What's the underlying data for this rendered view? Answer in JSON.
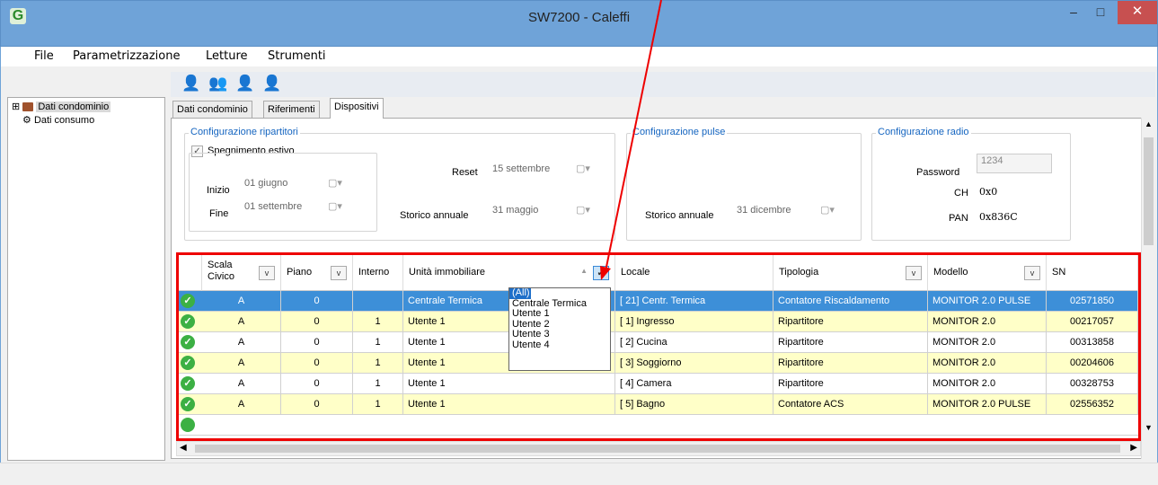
{
  "window": {
    "title": "SW7200 - Caleffi",
    "app_icon_glyph": "G",
    "minimize": "–",
    "maximize": "□",
    "close": "✕"
  },
  "menu": [
    "File",
    "Parametrizzazione",
    "Letture",
    "Strumenti"
  ],
  "toolbar": {
    "icons": [
      "add-user-icon",
      "users-icon",
      "user-arrow-icon",
      "user-remove-icon"
    ]
  },
  "tree": {
    "items": [
      {
        "label": "Dati condominio",
        "expander": "⊞"
      },
      {
        "label": "Dati consumo"
      }
    ]
  },
  "tabs": [
    "Dati condominio",
    "Riferimenti",
    "Dispositivi"
  ],
  "config_ripartitori": {
    "legend": "Configurazione ripartitori",
    "spegnimento": {
      "label": "Spegnimento estivo",
      "checked": true
    },
    "inizio_label": "Inizio",
    "inizio_value": "01  giugno",
    "fine_label": "Fine",
    "fine_value": "01 settembre",
    "reset_label": "Reset",
    "reset_value": "15 settembre",
    "storico_label": "Storico annuale",
    "storico_value": "31  maggio"
  },
  "config_pulse": {
    "legend": "Configurazione pulse",
    "storico_label": "Storico annuale",
    "storico_value": "31 dicembre"
  },
  "config_radio": {
    "legend": "Configurazione radio",
    "password_label": "Password",
    "password_value": "1234",
    "ch_label": "CH",
    "ch_value": "0x0",
    "pan_label": "PAN",
    "pan_value": "0x836C"
  },
  "grid": {
    "headers": [
      {
        "key": "scala",
        "label": "Scala\nCivico",
        "filter": true
      },
      {
        "key": "piano",
        "label": "Piano",
        "filter": true
      },
      {
        "key": "interno",
        "label": "Interno",
        "filter": false
      },
      {
        "key": "unita",
        "label": "Unità immobiliare",
        "filter": true,
        "sort": "▲"
      },
      {
        "key": "locale",
        "label": "Locale",
        "filter": false
      },
      {
        "key": "tipologia",
        "label": "Tipologia",
        "filter": true
      },
      {
        "key": "modello",
        "label": "Modello",
        "filter": true
      },
      {
        "key": "sn",
        "label": "SN",
        "filter": false
      }
    ],
    "filter_glyph": "✓",
    "dropdown_glyph": "v",
    "status_glyph": "✓",
    "rows": [
      {
        "scala": "A",
        "piano": "0",
        "interno": "",
        "unita": "Centrale Termica",
        "locale": "[ 21] Centr. Termica",
        "tipologia": "Contatore Riscaldamento",
        "modello": "MONITOR 2.0 PULSE",
        "sn": "02571850",
        "style": "selected"
      },
      {
        "scala": "A",
        "piano": "0",
        "interno": "1",
        "unita": "Utente 1",
        "locale": "[  1] Ingresso",
        "tipologia": "Ripartitore",
        "modello": "MONITOR 2.0",
        "sn": "00217057",
        "style": "yellow"
      },
      {
        "scala": "A",
        "piano": "0",
        "interno": "1",
        "unita": "Utente 1",
        "locale": "[  2] Cucina",
        "tipologia": "Ripartitore",
        "modello": "MONITOR 2.0",
        "sn": "00313858",
        "style": "white"
      },
      {
        "scala": "A",
        "piano": "0",
        "interno": "1",
        "unita": "Utente 1",
        "locale": "[  3] Soggiorno",
        "tipologia": "Ripartitore",
        "modello": "MONITOR 2.0",
        "sn": "00204606",
        "style": "yellow"
      },
      {
        "scala": "A",
        "piano": "0",
        "interno": "1",
        "unita": "Utente 1",
        "locale": "[  4] Camera",
        "tipologia": "Ripartitore",
        "modello": "MONITOR 2.0",
        "sn": "00328753",
        "style": "white"
      },
      {
        "scala": "A",
        "piano": "0",
        "interno": "1",
        "unita": "Utente 1",
        "locale": "[  5] Bagno",
        "tipologia": "Contatore ACS",
        "modello": "MONITOR 2.0 PULSE",
        "sn": "02556352",
        "style": "yellow"
      }
    ]
  },
  "filter_popup": {
    "options": [
      "(All)",
      "Centrale Termica",
      "Utente 1",
      "Utente 2",
      "Utente 3",
      "Utente 4"
    ],
    "highlighted": 0
  },
  "colors": {
    "selected_row": "#3d8fd8",
    "yellow_row": "#ffffc8",
    "highlight_border": "#e00000"
  }
}
